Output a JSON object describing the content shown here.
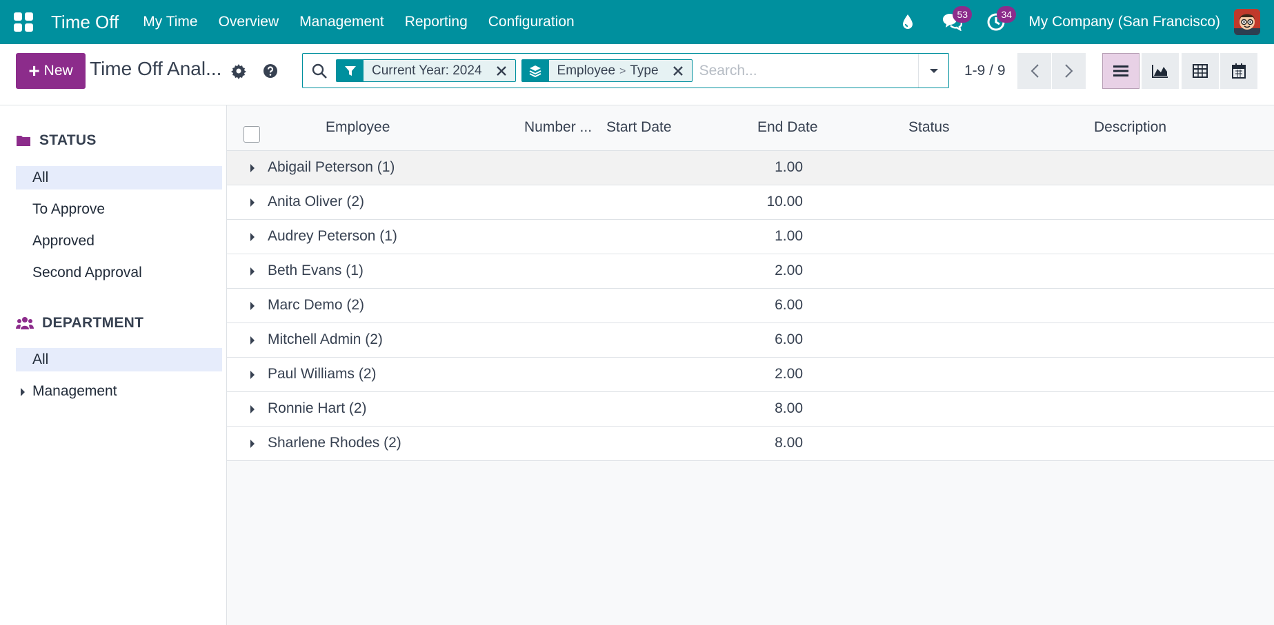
{
  "navbar": {
    "app_title": "Time Off",
    "menu": [
      "My Time",
      "Overview",
      "Management",
      "Reporting",
      "Configuration"
    ],
    "messages_count": "53",
    "activities_count": "34",
    "company": "My Company (San Francisco)",
    "icons": [
      "apps-grid-icon",
      "water-drop-icon",
      "chat-icon",
      "clock-activity-icon"
    ]
  },
  "control_panel": {
    "new_label": "New",
    "view_title": "Time Off Anal...",
    "search": {
      "placeholder": "Search...",
      "filter_facet": "Current Year: 2024",
      "groupby_facet": [
        "Employee",
        "Type"
      ],
      "groupby_separator": ">"
    },
    "pager": "1-9 / 9",
    "views": [
      "list",
      "graph",
      "pivot",
      "calendar"
    ],
    "active_view": "list"
  },
  "sidebar": {
    "status": {
      "heading": "STATUS",
      "items": [
        "All",
        "To Approve",
        "Approved",
        "Second Approval"
      ],
      "active": "All"
    },
    "department": {
      "heading": "DEPARTMENT",
      "items": [
        "All",
        "Management"
      ],
      "active": "All"
    }
  },
  "list": {
    "columns": [
      "Employee",
      "Number ...",
      "Start Date",
      "End Date",
      "Status",
      "Description"
    ],
    "groups": [
      {
        "name": "Abigail Peterson (1)",
        "number": "1.00"
      },
      {
        "name": "Anita Oliver (2)",
        "number": "10.00"
      },
      {
        "name": "Audrey Peterson (1)",
        "number": "1.00"
      },
      {
        "name": "Beth Evans (1)",
        "number": "2.00"
      },
      {
        "name": "Marc Demo (2)",
        "number": "6.00"
      },
      {
        "name": "Mitchell Admin (2)",
        "number": "6.00"
      },
      {
        "name": "Paul Williams (2)",
        "number": "2.00"
      },
      {
        "name": "Ronnie Hart (2)",
        "number": "8.00"
      },
      {
        "name": "Sharlene Rhodes (2)",
        "number": "8.00"
      }
    ]
  },
  "colors": {
    "brand": "#00909e",
    "primary": "#8c2c8b",
    "active_filter_bg": "#e6ecfb"
  }
}
